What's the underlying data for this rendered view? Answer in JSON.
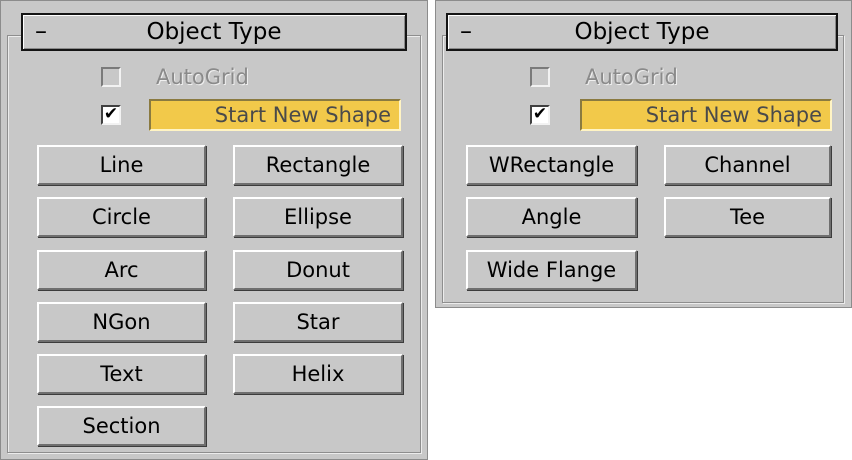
{
  "left_panel": {
    "header": {
      "collapse_symbol": "–",
      "title": "Object Type"
    },
    "autogrid": {
      "label": "AutoGrid",
      "checked": false,
      "enabled": false
    },
    "start_new_shape": {
      "checked": true,
      "label": "Start New Shape"
    },
    "buttons": [
      "Line",
      "Rectangle",
      "Circle",
      "Ellipse",
      "Arc",
      "Donut",
      "NGon",
      "Star",
      "Text",
      "Helix",
      "Section"
    ]
  },
  "right_panel": {
    "header": {
      "collapse_symbol": "–",
      "title": "Object Type"
    },
    "autogrid": {
      "label": "AutoGrid",
      "checked": false,
      "enabled": false
    },
    "start_new_shape": {
      "checked": true,
      "label": "Start New Shape"
    },
    "buttons": [
      "WRectangle",
      "Channel",
      "Angle",
      "Tee",
      "Wide Flange"
    ]
  },
  "checkmark_glyph": "✔",
  "colors": {
    "panel_bg": "#c8c8c8",
    "highlight_button": "#f2c94a",
    "disabled_text": "#8a8a8a"
  }
}
